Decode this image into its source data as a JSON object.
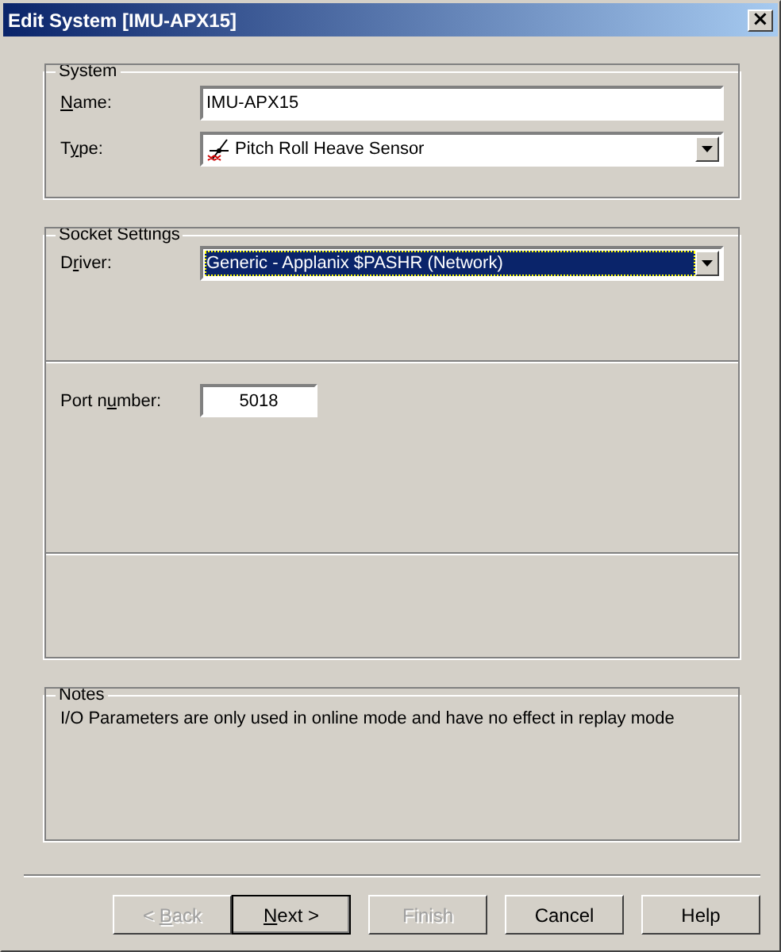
{
  "window": {
    "title": "Edit System [IMU-APX15]",
    "close": "×"
  },
  "system": {
    "legend": "System",
    "name": {
      "label": {
        "key": "N",
        "post": "ame:"
      },
      "value": "IMU-APX15"
    },
    "type": {
      "label": {
        "pre": "T",
        "key": "y",
        "post": "pe:"
      },
      "value": "Pitch Roll Heave Sensor"
    }
  },
  "socket_settings": {
    "legend": "Socket Settings",
    "driver": {
      "label": {
        "pre": "D",
        "key": "r",
        "post": "iver:"
      },
      "value": "Generic - Applanix $PASHR (Network)",
      "focused": true
    },
    "port": {
      "label": {
        "pre": "Port n",
        "key": "u",
        "post": "mber:"
      },
      "value": "5018"
    }
  },
  "notes": {
    "legend": "Notes",
    "text": "I/O Parameters are only used in online mode and have no effect in replay mode"
  },
  "buttons": [
    {
      "pre": "< ",
      "key": "B",
      "post": "ack",
      "disabled": true,
      "default": false
    },
    {
      "key": "N",
      "post": "ext >",
      "disabled": false,
      "default": true
    },
    {
      "pre": "Finish",
      "disabled": true,
      "default": false
    },
    {
      "pre": "Cancel",
      "disabled": false,
      "default": false
    },
    {
      "pre": "Help",
      "disabled": false,
      "default": false
    }
  ]
}
